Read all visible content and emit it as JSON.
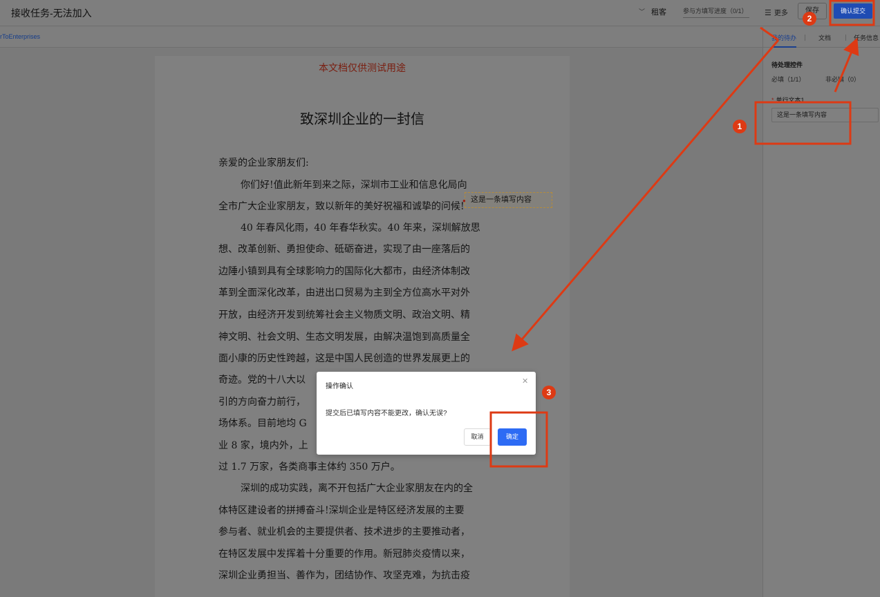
{
  "header": {
    "title": "接收任务-无法加入",
    "role": "租客",
    "progress_label": "参与方填写进度（0/1）",
    "more_label": "更多",
    "save_label": "保存",
    "submit_label": "确认提交"
  },
  "subbar": {
    "link_text": "rToEnterprises"
  },
  "document": {
    "watermark": "本文档仅供测试用途",
    "title": "致深圳企业的一封信",
    "lines": [
      "亲爱的企业家朋友们:",
      "你们好!值此新年到来之际，深圳市工业和信息化局向",
      "全市广大企业家朋友，致以新年的美好祝福和诚挚的问候!",
      "40 年春风化雨，40 年春华秋实。40 年来，深圳解放思",
      "想、改革创新、勇担使命、砥砺奋进，实现了由一座落后的",
      "边陲小镇到具有全球影响力的国际化大都市，由经济体制改",
      "革到全面深化改革，由进出口贸易为主到全方位高水平对外",
      "开放，由经济开发到统筹社会主义物质文明、政治文明、精",
      "神文明、社会文明、生态文明发展，由解决温饱到高质量全",
      "面小康的历史性跨越，这是中国人民创造的世界发展更上的",
      "奇迹。党的十八大以",
      "引的方向奋力前行，",
      "场体系。目前地均 G",
      "业 8 家，境内外，上",
      "过 1.7 万家，各类商事主体约 350 万户。",
      "深圳的成功实践，离不开包括广大企业家朋友在内的全",
      "体特区建设者的拼搏奋斗!深圳企业是特区经济发展的主要",
      "参与者、就业机会的主要提供者、技术进步的主要推动者，",
      "在特区发展中发挥着十分重要的作用。新冠肺炎疫情以来，",
      "深圳企业勇担当、善作为，团结协作、攻坚克难，为抗击疫"
    ],
    "fill_field_value": "这是一条填写内容"
  },
  "right_panel": {
    "tabs": [
      {
        "label": "我的待办",
        "active": true
      },
      {
        "label": "文档",
        "active": false
      },
      {
        "label": "任务信息",
        "active": false
      }
    ],
    "section_title": "待处理控件",
    "required_count": "必填（1/1）",
    "optional_count": "非必填（0）",
    "field_label": "单行文本1",
    "field_value": "这是一条填写内容"
  },
  "modal": {
    "title": "操作确认",
    "body": "提交后已填写内容不能更改，确认无误?",
    "cancel_label": "取消",
    "ok_label": "确定"
  },
  "annotations": {
    "badges": [
      "1",
      "2",
      "3"
    ],
    "color": "#dd3a14"
  },
  "colors": {
    "primary": "#2d6bf4",
    "overlay_primary": "#1f4cb3",
    "annotation": "#dd3a14"
  },
  "icons": [
    "chevron-down-icon",
    "menu-icon",
    "close-icon",
    "required-dot-icon"
  ]
}
